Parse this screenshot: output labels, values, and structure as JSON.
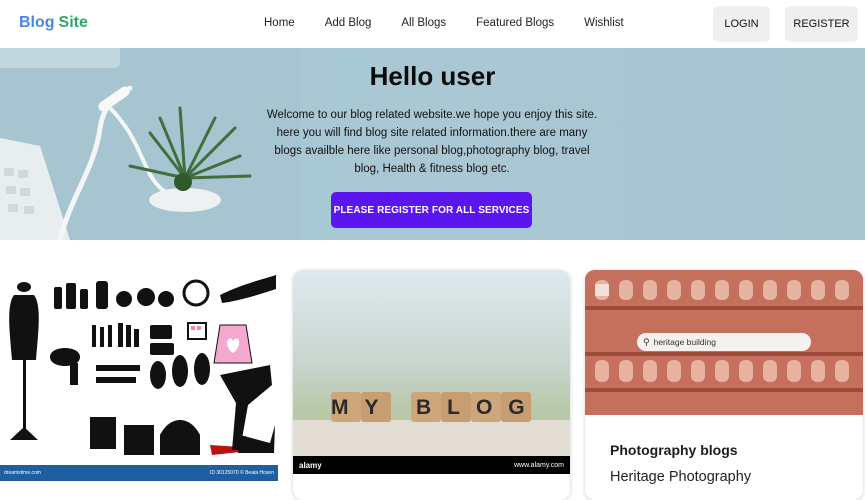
{
  "brand": {
    "part1": "Blog",
    "part2": "Site"
  },
  "nav": {
    "links": [
      "Home",
      "Add Blog",
      "All Blogs",
      "Featured Blogs",
      "Wishlist"
    ]
  },
  "auth": {
    "login": "LOGIN",
    "register": "REGISTER"
  },
  "hero": {
    "title": "Hello user",
    "text": "Welcome to our blog related website.we hope you enjoy this site. here you will find blog site related information.there are many blogs availble here like personal blog,photography blog, travel blog, Health & fitness blog etc.",
    "cta": "PLEASE REGISTER FOR ALL SERVICES"
  },
  "cards": [
    {
      "image_footer_left": "dreamstime.com",
      "image_footer_right": "ID 30125070 © Beata Hosen"
    },
    {
      "image_text": "MY BLOG",
      "image_footer_left": "alamy",
      "image_footer_right": "www.alamy.com"
    },
    {
      "search_text": "heritage building",
      "title": "Photography blogs",
      "subtitle": "Heritage Photography"
    }
  ],
  "colors": {
    "brand_blue": "#4a86e8",
    "brand_green": "#2ea66a",
    "cta": "#5b16f0",
    "hero_bg": "#a8c6d2"
  }
}
